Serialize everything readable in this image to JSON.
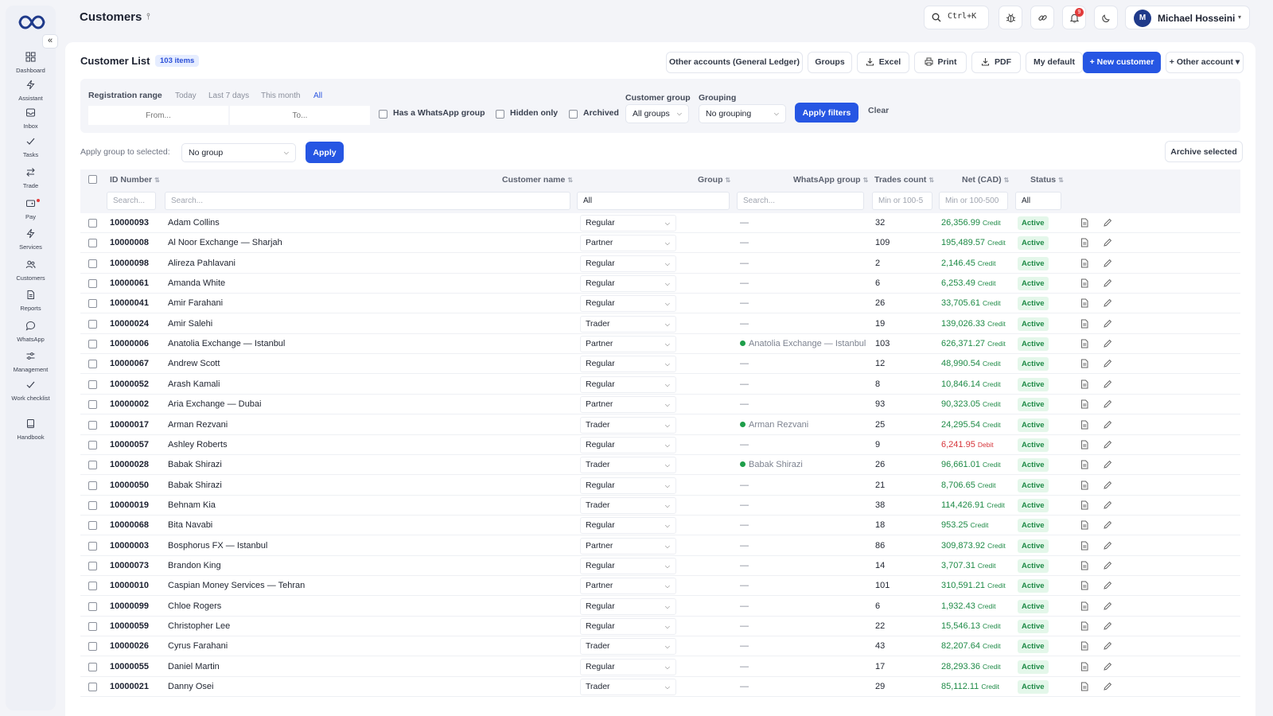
{
  "app": {
    "page_title": "Customers",
    "pin_glyph": "⫯"
  },
  "sidebar": {
    "collapse_glyph": "«",
    "items": [
      {
        "label": "Dashboard",
        "icon": "grid-icon"
      },
      {
        "label": "Assistant",
        "icon": "bolt-icon"
      },
      {
        "label": "Inbox",
        "icon": "inbox-icon"
      },
      {
        "label": "Tasks",
        "icon": "check-icon"
      },
      {
        "label": "Trade",
        "icon": "swap-icon"
      },
      {
        "label": "Pay",
        "icon": "wallet-icon"
      },
      {
        "label": "Services",
        "icon": "bolt-icon"
      },
      {
        "label": "Customers",
        "icon": "users-icon"
      },
      {
        "label": "Reports",
        "icon": "document-icon"
      },
      {
        "label": "WhatsApp",
        "icon": "chat-icon"
      },
      {
        "label": "Management",
        "icon": "sliders-icon"
      },
      {
        "label": "Work checklist",
        "icon": "check-icon"
      },
      {
        "label": "Handbook",
        "icon": "book-icon"
      }
    ]
  },
  "topbar": {
    "search_shortcut": "Ctrl+K",
    "notifications_count": "9",
    "user_initial": "M",
    "user_name": "Michael Hosseini",
    "user_caret": "▾"
  },
  "list": {
    "title": "Customer List",
    "count_label": "103 items",
    "buttons": {
      "other_accounts": "Other accounts (General Ledger)",
      "groups": "Groups",
      "excel": "Excel",
      "print": "Print",
      "pdf": "PDF",
      "my_default": "My default",
      "new_customer": "+ New customer",
      "other_account": "+ Other account ▾"
    }
  },
  "filters": {
    "registration_range_label": "Registration range",
    "range_options": [
      "Today",
      "Last 7 days",
      "This month",
      "All"
    ],
    "active_range": "All",
    "from_placeholder": "From...",
    "to_placeholder": "To...",
    "has_whatsapp_label": "Has a WhatsApp group",
    "hidden_only_label": "Hidden only",
    "archived_label": "Archived",
    "customer_group_label": "Customer group",
    "customer_group_value": "All groups",
    "grouping_label": "Grouping",
    "grouping_value": "No grouping",
    "apply_label": "Apply filters",
    "clear_label": "Clear"
  },
  "bulk": {
    "apply_group_label": "Apply group to selected:",
    "group_value": "No group",
    "apply_label": "Apply",
    "archive_label": "Archive selected"
  },
  "table": {
    "columns": {
      "id": "ID Number",
      "name": "Customer name",
      "group": "Group",
      "whatsapp": "WhatsApp group",
      "trades": "Trades count",
      "net": "Net (CAD)",
      "status": "Status"
    },
    "sort_glyph": "⇅",
    "filter_row": {
      "id": "Search...",
      "name": "Search...",
      "group": "All",
      "whatsapp": "Search...",
      "trades": "Min or 100-5",
      "net": "Min or 100-500",
      "status": "All"
    },
    "credit_label": "Credit",
    "debit_label": "Debit",
    "rows": [
      {
        "id": "10000093",
        "name": "Adam Collins",
        "group": "Regular",
        "whatsapp": "—",
        "trades": "32",
        "net": "26,356.99",
        "kind": "Credit",
        "status": "Active"
      },
      {
        "id": "10000008",
        "name": "Al Noor Exchange — Sharjah",
        "group": "Partner",
        "whatsapp": "—",
        "trades": "109",
        "net": "195,489.57",
        "kind": "Credit",
        "status": "Active"
      },
      {
        "id": "10000098",
        "name": "Alireza Pahlavani",
        "group": "Regular",
        "whatsapp": "—",
        "trades": "2",
        "net": "2,146.45",
        "kind": "Credit",
        "status": "Active"
      },
      {
        "id": "10000061",
        "name": "Amanda White",
        "group": "Regular",
        "whatsapp": "—",
        "trades": "6",
        "net": "6,253.49",
        "kind": "Credit",
        "status": "Active"
      },
      {
        "id": "10000041",
        "name": "Amir Farahani",
        "group": "Regular",
        "whatsapp": "—",
        "trades": "26",
        "net": "33,705.61",
        "kind": "Credit",
        "status": "Active"
      },
      {
        "id": "10000024",
        "name": "Amir Salehi",
        "group": "Trader",
        "whatsapp": "—",
        "trades": "19",
        "net": "139,026.33",
        "kind": "Credit",
        "status": "Active"
      },
      {
        "id": "10000006",
        "name": "Anatolia Exchange — Istanbul",
        "group": "Partner",
        "whatsapp": "Anatolia Exchange — Istanbul",
        "trades": "103",
        "net": "626,371.27",
        "kind": "Credit",
        "status": "Active"
      },
      {
        "id": "10000067",
        "name": "Andrew Scott",
        "group": "Regular",
        "whatsapp": "—",
        "trades": "12",
        "net": "48,990.54",
        "kind": "Credit",
        "status": "Active"
      },
      {
        "id": "10000052",
        "name": "Arash Kamali",
        "group": "Regular",
        "whatsapp": "—",
        "trades": "8",
        "net": "10,846.14",
        "kind": "Credit",
        "status": "Active"
      },
      {
        "id": "10000002",
        "name": "Aria Exchange — Dubai",
        "group": "Partner",
        "whatsapp": "—",
        "trades": "93",
        "net": "90,323.05",
        "kind": "Credit",
        "status": "Active"
      },
      {
        "id": "10000017",
        "name": "Arman Rezvani",
        "group": "Trader",
        "whatsapp": "Arman Rezvani",
        "trades": "25",
        "net": "24,295.54",
        "kind": "Credit",
        "status": "Active"
      },
      {
        "id": "10000057",
        "name": "Ashley Roberts",
        "group": "Regular",
        "whatsapp": "—",
        "trades": "9",
        "net": "6,241.95",
        "kind": "Debit",
        "status": "Active"
      },
      {
        "id": "10000028",
        "name": "Babak Shirazi",
        "group": "Trader",
        "whatsapp": "Babak Shirazi",
        "trades": "26",
        "net": "96,661.01",
        "kind": "Credit",
        "status": "Active"
      },
      {
        "id": "10000050",
        "name": "Babak Shirazi",
        "group": "Regular",
        "whatsapp": "—",
        "trades": "21",
        "net": "8,706.65",
        "kind": "Credit",
        "status": "Active"
      },
      {
        "id": "10000019",
        "name": "Behnam Kia",
        "group": "Trader",
        "whatsapp": "—",
        "trades": "38",
        "net": "114,426.91",
        "kind": "Credit",
        "status": "Active"
      },
      {
        "id": "10000068",
        "name": "Bita Navabi",
        "group": "Regular",
        "whatsapp": "—",
        "trades": "18",
        "net": "953.25",
        "kind": "Credit",
        "status": "Active"
      },
      {
        "id": "10000003",
        "name": "Bosphorus FX — Istanbul",
        "group": "Partner",
        "whatsapp": "—",
        "trades": "86",
        "net": "309,873.92",
        "kind": "Credit",
        "status": "Active"
      },
      {
        "id": "10000073",
        "name": "Brandon King",
        "group": "Regular",
        "whatsapp": "—",
        "trades": "14",
        "net": "3,707.31",
        "kind": "Credit",
        "status": "Active"
      },
      {
        "id": "10000010",
        "name": "Caspian Money Services — Tehran",
        "group": "Partner",
        "whatsapp": "—",
        "trades": "101",
        "net": "310,591.21",
        "kind": "Credit",
        "status": "Active"
      },
      {
        "id": "10000099",
        "name": "Chloe Rogers",
        "group": "Regular",
        "whatsapp": "—",
        "trades": "6",
        "net": "1,932.43",
        "kind": "Credit",
        "status": "Active"
      },
      {
        "id": "10000059",
        "name": "Christopher Lee",
        "group": "Regular",
        "whatsapp": "—",
        "trades": "22",
        "net": "15,546.13",
        "kind": "Credit",
        "status": "Active"
      },
      {
        "id": "10000026",
        "name": "Cyrus Farahani",
        "group": "Trader",
        "whatsapp": "—",
        "trades": "43",
        "net": "82,207.64",
        "kind": "Credit",
        "status": "Active"
      },
      {
        "id": "10000055",
        "name": "Daniel Martin",
        "group": "Regular",
        "whatsapp": "—",
        "trades": "17",
        "net": "28,293.36",
        "kind": "Credit",
        "status": "Active"
      },
      {
        "id": "10000021",
        "name": "Danny Osei",
        "group": "Trader",
        "whatsapp": "—",
        "trades": "29",
        "net": "85,112.11",
        "kind": "Credit",
        "status": "Active"
      }
    ]
  },
  "colors": {
    "accent": "#2656e3",
    "credit": "#1e8a46",
    "debit": "#d6343a",
    "status_bg": "#e4f7ea"
  }
}
